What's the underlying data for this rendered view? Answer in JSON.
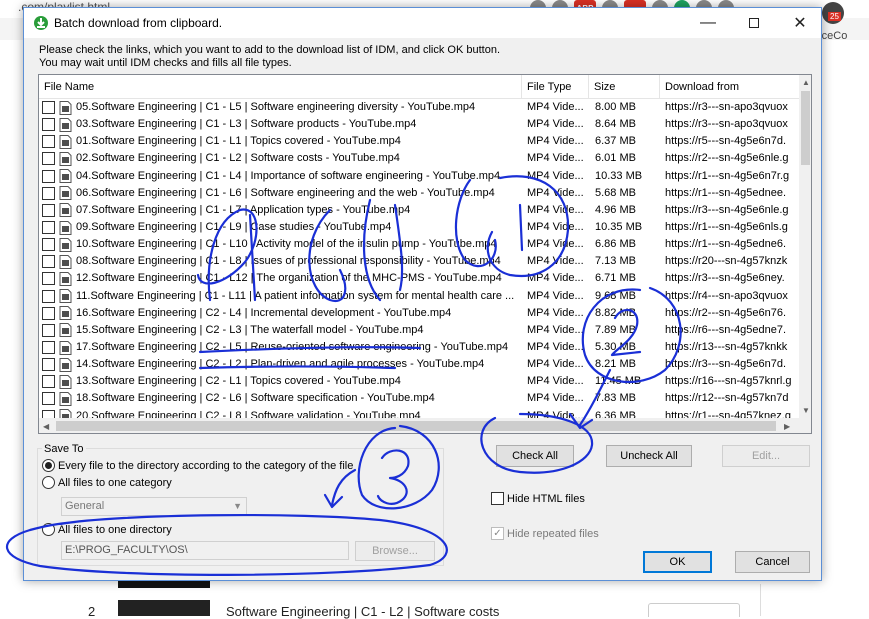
{
  "browser": {
    "url_fragment": ".com/playlist.html",
    "side_text": "rceCo",
    "badge_count": "25",
    "abp_label": "ABP",
    "bottom_row": {
      "index": "2",
      "title": "Software Engineering | C1 - L2 | Software costs"
    }
  },
  "dialog": {
    "title": "Batch download from clipboard.",
    "instruction_1": "Please check the links, which you want to add to the download list of IDM, and click OK button.",
    "instruction_2": "You may wait until IDM checks and fills all file types.",
    "columns": [
      "File Name",
      "File Type",
      "Size",
      "Download from"
    ],
    "rows": [
      {
        "name": "05.Software Engineering | C1 - L5 | Software engineering diversity - YouTube.mp4",
        "type": "MP4 Vide...",
        "size": "8.00  MB",
        "from": "https://r3---sn-apo3qvuox"
      },
      {
        "name": "03.Software Engineering | C1 - L3 | Software products - YouTube.mp4",
        "type": "MP4 Vide...",
        "size": "8.64  MB",
        "from": "https://r3---sn-apo3qvuox"
      },
      {
        "name": "01.Software Engineering | C1 - L1 | Topics covered - YouTube.mp4",
        "type": "MP4 Vide...",
        "size": "6.37  MB",
        "from": "https://r5---sn-4g5e6n7d."
      },
      {
        "name": "02.Software Engineering | C1 - L2 | Software costs - YouTube.mp4",
        "type": "MP4 Vide...",
        "size": "6.01  MB",
        "from": "https://r2---sn-4g5e6nle.g"
      },
      {
        "name": "04.Software Engineering | C1 - L4 | Importance of software engineering - YouTube.mp4",
        "type": "MP4 Vide...",
        "size": "10.33  MB",
        "from": "https://r1---sn-4g5e6n7r.g"
      },
      {
        "name": "06.Software Engineering | C1 - L6 | Software engineering and the web - YouTube.mp4",
        "type": "MP4 Vide...",
        "size": "5.68  MB",
        "from": "https://r1---sn-4g5ednee."
      },
      {
        "name": "07.Software Engineering | C1 - L7 | Application types - YouTube.mp4",
        "type": "MP4 Vide...",
        "size": "4.96  MB",
        "from": "https://r3---sn-4g5e6nle.g"
      },
      {
        "name": "09.Software Engineering | C1 - L9 | Case studies - YouTube.mp4",
        "type": "MP4 Vide...",
        "size": "10.35  MB",
        "from": "https://r1---sn-4g5e6nls.g"
      },
      {
        "name": "10.Software Engineering | C1 - L10 | Activity model of the insulin pump - YouTube.mp4",
        "type": "MP4 Vide...",
        "size": "6.86  MB",
        "from": "https://r1---sn-4g5edne6."
      },
      {
        "name": "08.Software Engineering | C1 - L8 | Issues of professional responsibility - YouTube.mp4",
        "type": "MP4 Vide...",
        "size": "7.13  MB",
        "from": "https://r20---sn-4g57knzk"
      },
      {
        "name": "12.Software Engineering | C1 - L12 | The organization of the MHC-PMS - YouTube.mp4",
        "type": "MP4 Vide...",
        "size": "6.71  MB",
        "from": "https://r3---sn-4g5e6ney."
      },
      {
        "name": "11.Software Engineering | C1 - L11 | A patient information system for mental health care ...",
        "type": "MP4 Vide...",
        "size": "9.68  MB",
        "from": "https://r4---sn-apo3qvuox"
      },
      {
        "name": "16.Software Engineering | C2 - L4 | Incremental development - YouTube.mp4",
        "type": "MP4 Vide...",
        "size": "8.82  MB",
        "from": "https://r2---sn-4g5e6n76."
      },
      {
        "name": "15.Software Engineering | C2 - L3 | The waterfall model - YouTube.mp4",
        "type": "MP4 Vide...",
        "size": "7.89  MB",
        "from": "https://r6---sn-4g5edne7."
      },
      {
        "name": "17.Software Engineering | C2 - L5 | Reuse-oriented software engineering - YouTube.mp4",
        "type": "MP4 Vide...",
        "size": "5.30  MB",
        "from": "https://r13---sn-4g57knkk"
      },
      {
        "name": "14.Software Engineering | C2 - L2 | Plan-driven and agile processes - YouTube.mp4",
        "type": "MP4 Vide...",
        "size": "8.21  MB",
        "from": "https://r3---sn-4g5e6n7d."
      },
      {
        "name": "13.Software Engineering | C2 - L1 | Topics covered - YouTube.mp4",
        "type": "MP4 Vide...",
        "size": "11.45  MB",
        "from": "https://r16---sn-4g57knrl.g"
      },
      {
        "name": "18.Software Engineering | C2 - L6 | Software specification - YouTube.mp4",
        "type": "MP4 Vide...",
        "size": "7.83  MB",
        "from": "https://r12---sn-4g57kn7d"
      },
      {
        "name": "20.Software Engineering | C2 - L8 | Software validation - YouTube.mp4",
        "type": "MP4 Vide...",
        "size": "6.36  MB",
        "from": "https://r1---sn-4g57knez.g"
      }
    ],
    "save_to": {
      "legend": "Save To",
      "opt_category": "Every file to the directory according to the category of the file",
      "opt_one_category": "All files to one category",
      "category_value": "General",
      "opt_one_directory": "All files to one directory",
      "directory_value": "E:\\PROG_FACULTY\\OS\\",
      "browse_label": "Browse..."
    },
    "buttons": {
      "check_all": "Check All",
      "uncheck_all": "Uncheck All",
      "edit": "Edit...",
      "ok": "OK",
      "cancel": "Cancel"
    },
    "hide_html": "Hide HTML files",
    "hide_repeated": "Hide repeated files"
  },
  "colors": {
    "dialog_border": "#5b8fd6",
    "default_button": "#0078d7",
    "annotation_ink": "#1a2fd6"
  },
  "icons": [
    "idm-app-icon",
    "minimize-icon",
    "maximize-icon",
    "close-icon",
    "file-icon",
    "chevron-down-icon"
  ]
}
